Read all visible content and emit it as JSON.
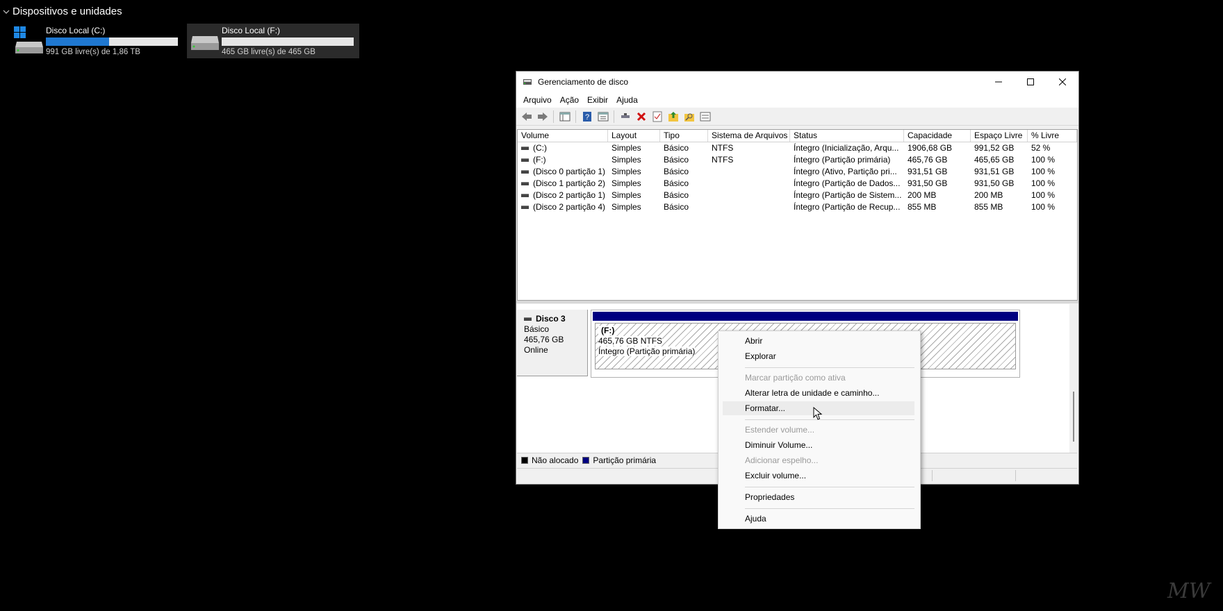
{
  "explorer": {
    "section_title": "Dispositivos e unidades",
    "drives": [
      {
        "name": "Disco Local (C:)",
        "free_text": "991 GB livre(s) de 1,86 TB",
        "used_fraction": 0.48
      },
      {
        "name": "Disco Local (F:)",
        "free_text": "465 GB livre(s) de 465 GB",
        "used_fraction": 0.0
      }
    ]
  },
  "window": {
    "title": "Gerenciamento de disco",
    "menu": [
      "Arquivo",
      "Ação",
      "Exibir",
      "Ajuda"
    ],
    "toolbar_icons": [
      "back-arrow-icon",
      "forward-arrow-icon",
      "console-tree-icon",
      "help-icon",
      "properties-icon",
      "connect-icon",
      "delete-icon",
      "check-icon",
      "folder-up-icon",
      "folder-search-icon",
      "settings-list-icon"
    ],
    "columns": [
      "Volume",
      "Layout",
      "Tipo",
      "Sistema de Arquivos",
      "Status",
      "Capacidade",
      "Espaço Livre",
      "% Livre"
    ],
    "rows": [
      [
        "(C:)",
        "Simples",
        "Básico",
        "NTFS",
        "Íntegro (Inicialização, Arqu...",
        "1906,68 GB",
        "991,52 GB",
        "52 %"
      ],
      [
        "(F:)",
        "Simples",
        "Básico",
        "NTFS",
        "Íntegro (Partição primária)",
        "465,76 GB",
        "465,65 GB",
        "100 %"
      ],
      [
        "(Disco 0 partição 1)",
        "Simples",
        "Básico",
        "",
        "Íntegro (Ativo, Partição pri...",
        "931,51 GB",
        "931,51 GB",
        "100 %"
      ],
      [
        "(Disco 1 partição 2)",
        "Simples",
        "Básico",
        "",
        "Íntegro (Partição de Dados...",
        "931,50 GB",
        "931,50 GB",
        "100 %"
      ],
      [
        "(Disco 2 partição 1)",
        "Simples",
        "Básico",
        "",
        "Íntegro (Partição de Sistem...",
        "200 MB",
        "200 MB",
        "100 %"
      ],
      [
        "(Disco 2 partição 4)",
        "Simples",
        "Básico",
        "",
        "Íntegro (Partição de Recup...",
        "855 MB",
        "855 MB",
        "100 %"
      ]
    ],
    "disk": {
      "name": "Disco 3",
      "type": "Básico",
      "size": "465,76 GB",
      "state": "Online",
      "partition": {
        "letter": "(F:)",
        "size_fs": "465,76 GB NTFS",
        "status": "Íntegro (Partição primária)"
      }
    },
    "legend": [
      {
        "label": "Não alocado",
        "color": "#000000"
      },
      {
        "label": "Partição primária",
        "color": "#000080"
      }
    ]
  },
  "context_menu": {
    "items": [
      {
        "label": "Abrir",
        "enabled": true
      },
      {
        "label": "Explorar",
        "enabled": true
      },
      {
        "label": "Marcar partição como ativa",
        "enabled": false
      },
      {
        "label": "Alterar letra de unidade e caminho...",
        "enabled": true
      },
      {
        "label": "Formatar...",
        "enabled": true,
        "hovered": true
      },
      {
        "label": "Estender volume...",
        "enabled": false
      },
      {
        "label": "Diminuir Volume...",
        "enabled": true
      },
      {
        "label": "Adicionar espelho...",
        "enabled": false
      },
      {
        "label": "Excluir volume...",
        "enabled": true
      },
      {
        "label": "Propriedades",
        "enabled": true
      },
      {
        "label": "Ajuda",
        "enabled": true
      }
    ]
  },
  "watermark": "MW",
  "colors": {
    "accent": "#1f78d1",
    "partition_bar": "#000080"
  }
}
